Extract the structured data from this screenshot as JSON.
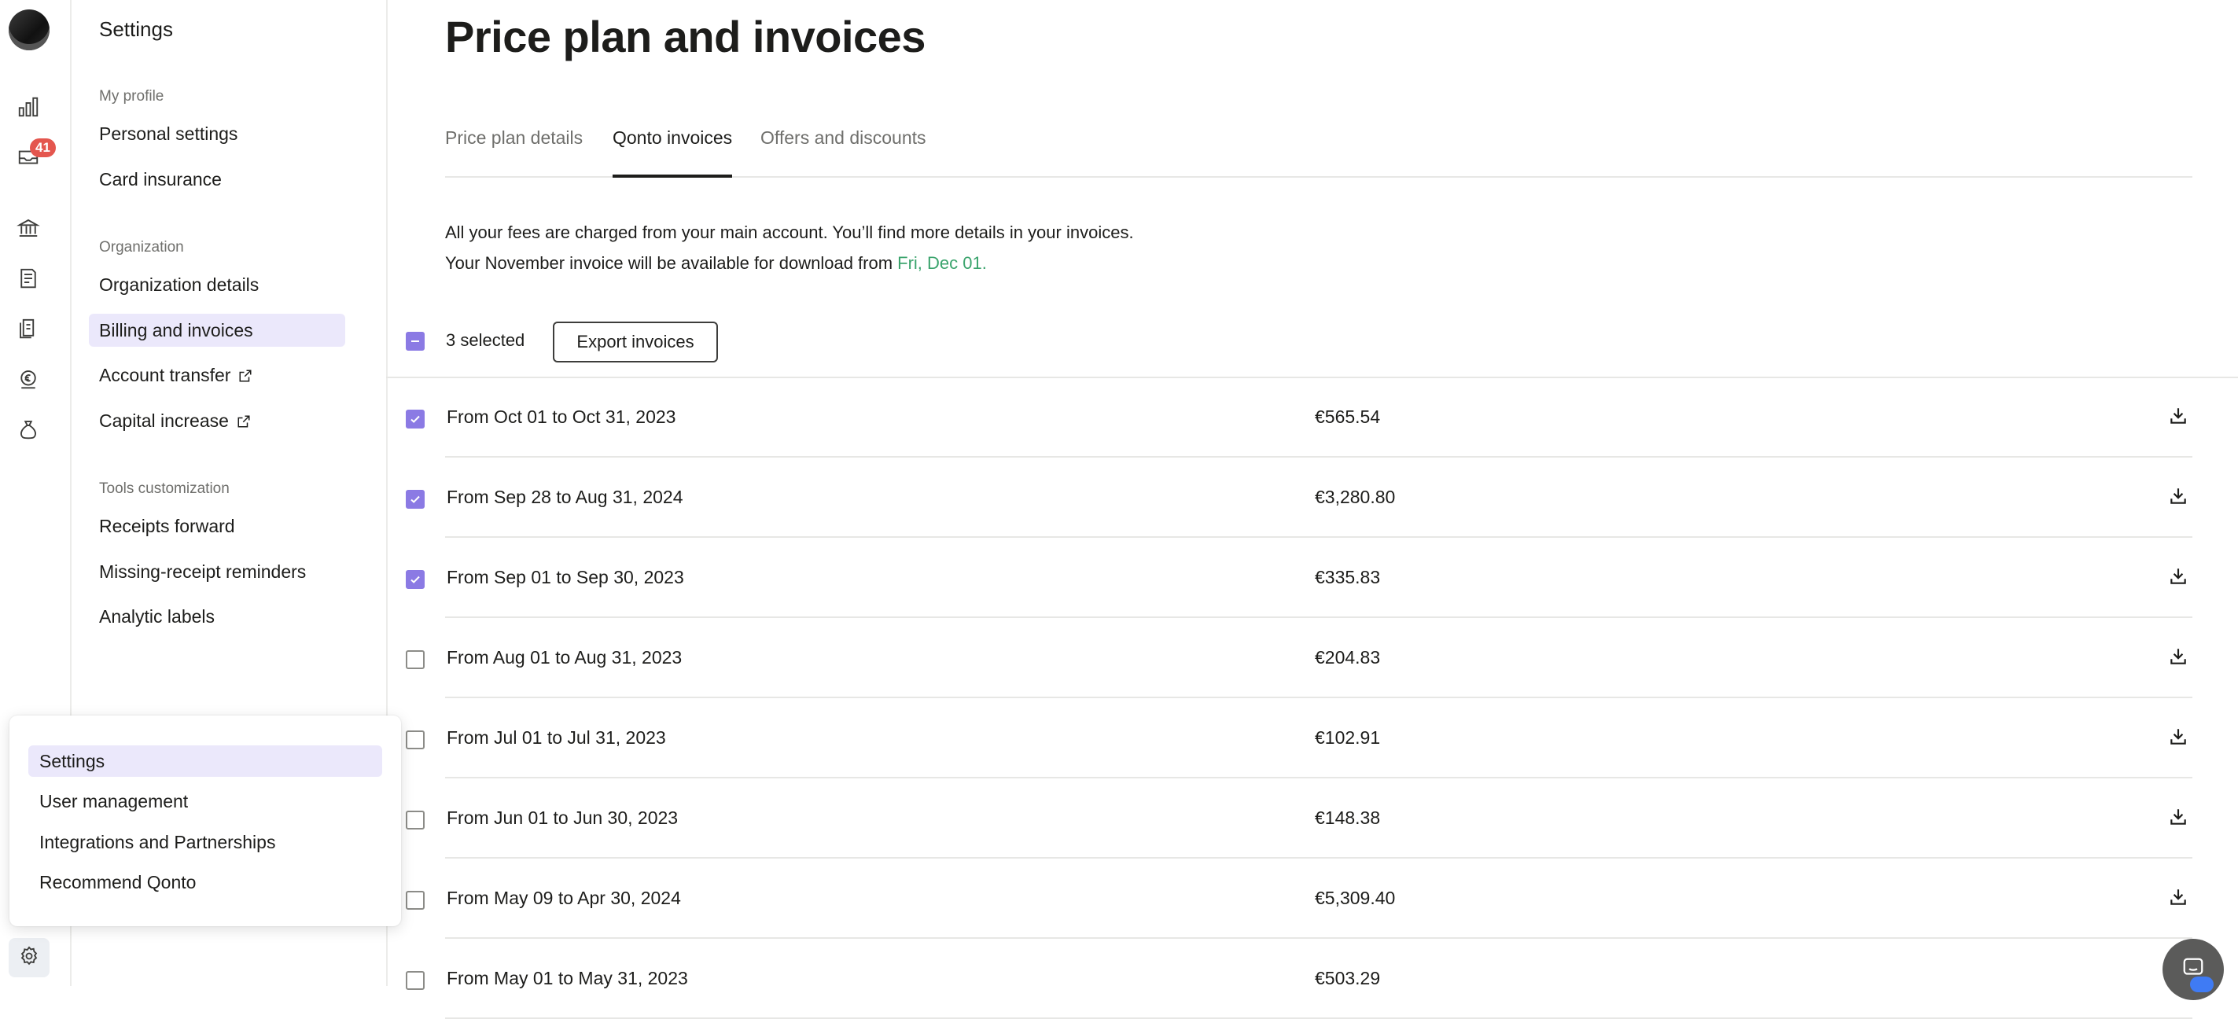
{
  "rail": {
    "badge_count": "41",
    "icons": [
      "analytics-icon",
      "inbox-icon",
      "bank-icon",
      "invoices-icon",
      "documents-icon",
      "payment-icon",
      "money-bag-icon",
      "gear-icon"
    ]
  },
  "sidebar": {
    "title": "Settings",
    "sections": [
      {
        "label": "My profile",
        "items": [
          "Personal settings",
          "Card insurance"
        ]
      },
      {
        "label": "Organization",
        "items": [
          "Organization details",
          "Billing and invoices",
          "Account transfer",
          "Capital increase"
        ]
      },
      {
        "label": "Tools customization",
        "items": [
          "Receipts forward",
          "Missing-receipt reminders",
          "Analytic labels"
        ]
      }
    ],
    "active_item": "Billing and invoices"
  },
  "page": {
    "title": "Price plan and invoices",
    "tabs": [
      "Price plan details",
      "Qonto invoices",
      "Offers and discounts"
    ],
    "active_tab": "Qonto invoices",
    "info_text": "All your fees are charged from your main account. You’ll find more details in your invoices. Your November invoice will be available for download from ",
    "info_date": "Fri, Dec 01."
  },
  "bulk": {
    "selected_label": "3 selected",
    "export_label": "Export invoices"
  },
  "invoices": [
    {
      "period": "From Oct 01 to Oct 31, 2023",
      "amount": "€565.54",
      "checked": true
    },
    {
      "period": "From Sep 28 to Aug 31, 2024",
      "amount": "€3,280.80",
      "checked": true
    },
    {
      "period": "From Sep 01 to Sep 30, 2023",
      "amount": "€335.83",
      "checked": true
    },
    {
      "period": "From Aug 01 to Aug 31, 2023",
      "amount": "€204.83",
      "checked": false
    },
    {
      "period": "From Jul 01 to Jul 31, 2023",
      "amount": "€102.91",
      "checked": false
    },
    {
      "period": "From Jun 01 to Jun 30, 2023",
      "amount": "€148.38",
      "checked": false
    },
    {
      "period": "From May 09 to Apr 30, 2024",
      "amount": "€5,309.40",
      "checked": false
    },
    {
      "period": "From May 01 to May 31, 2023",
      "amount": "€503.29",
      "checked": false
    }
  ],
  "popup_menu": {
    "items": [
      "Settings",
      "User management",
      "Integrations and Partnerships",
      "Recommend Qonto"
    ],
    "active_item": "Settings"
  },
  "colors": {
    "accent": "#8b7ae4",
    "active_bg": "#ebe8fb",
    "date_green": "#3ba46d",
    "badge_red": "#e4564e"
  }
}
